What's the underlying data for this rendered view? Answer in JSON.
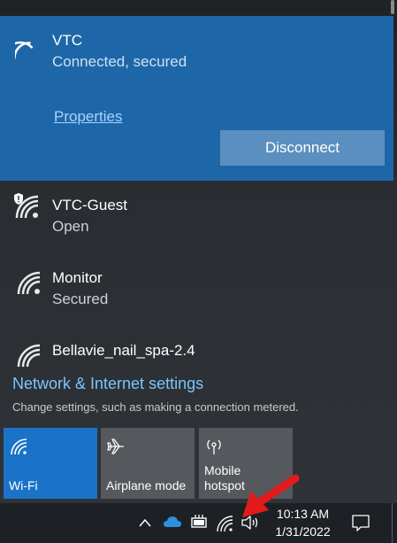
{
  "networks": {
    "connected": {
      "name": "VTC",
      "status": "Connected, secured",
      "properties_label": "Properties",
      "disconnect_label": "Disconnect"
    },
    "list": [
      {
        "name": "VTC-Guest",
        "status": "Open",
        "icon": "wifi-shield-icon"
      },
      {
        "name": "Monitor",
        "status": "Secured",
        "icon": "wifi-icon"
      },
      {
        "name": "Bellavie_nail_spa-2.4",
        "status": "",
        "icon": "wifi-icon"
      }
    ]
  },
  "settings": {
    "link": "Network & Internet settings",
    "description": "Change settings, such as making a connection metered."
  },
  "quick_actions": [
    {
      "label": "Wi-Fi",
      "icon": "wifi-icon",
      "active": true
    },
    {
      "label": "Airplane mode",
      "icon": "airplane-icon",
      "active": false
    },
    {
      "label": "Mobile\nhotspot",
      "icon": "hotspot-icon",
      "active": false
    }
  ],
  "taskbar": {
    "time": "10:13 AM",
    "date": "1/31/2022",
    "icons": [
      "chevron-up-icon",
      "onedrive-icon",
      "battery-icon",
      "wifi-icon",
      "volume-icon",
      "notification-icon"
    ]
  },
  "colors": {
    "accent": "#1d67a8",
    "link": "#7cc4ff",
    "annotation_arrow": "#e11b1b"
  }
}
